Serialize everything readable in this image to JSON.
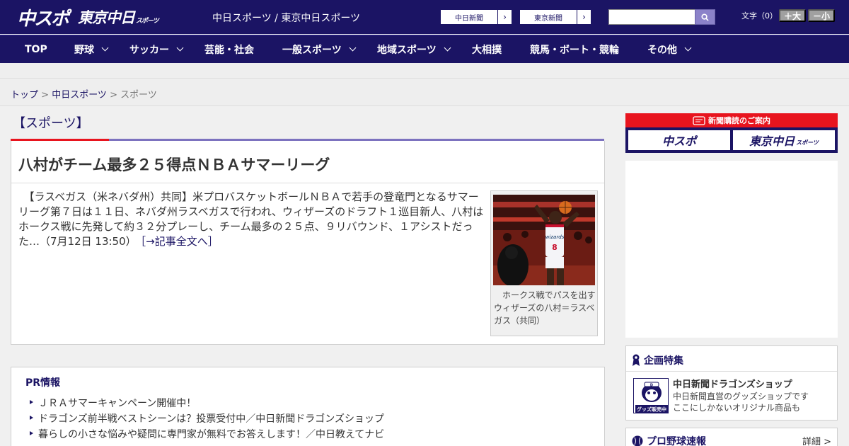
{
  "header": {
    "logo_chuspo": "中スポ",
    "logo_tokyo": "東京中日",
    "logo_tokyo_sub": "スポーツ",
    "title": "中日スポーツ / 東京中日スポーツ",
    "paper_links": [
      "中日新聞",
      "東京新聞"
    ],
    "search_placeholder": "",
    "font_label": "文字（0）",
    "font_plus": "＋大",
    "font_minus": "－小"
  },
  "nav": {
    "items": [
      {
        "label": "TOP"
      },
      {
        "label": "野球"
      },
      {
        "label": "サッカー"
      },
      {
        "label": "芸能・社会"
      },
      {
        "label": "一般スポーツ"
      },
      {
        "label": "地域スポーツ"
      },
      {
        "label": "大相撲"
      },
      {
        "label": "競馬・ボート・競輪"
      },
      {
        "label": "その他"
      }
    ]
  },
  "breadcrumb": {
    "home": "トップ",
    "sep": " > ",
    "parent": "中日スポーツ",
    "current": "スポーツ"
  },
  "section": {
    "heading": "【スポーツ】"
  },
  "article": {
    "title": "八村がチーム最多２５得点ＮＢＡサマーリーグ",
    "body": "　【ラスベガス（米ネバダ州）共同】米プロバスケットボールＮＢＡで若手の登竜門となるサマーリーグ第７日は１１日、ネバダ州ラスベガスで行われ、ウィザーズのドラフト１巡目新人、八村はホークス戦に先発して約３２分プレーし、チーム最多の２５点、９リバウンド、１アシストだった…（7月12日 13:50）",
    "more_link": "［→記事全文へ］",
    "photo_caption": "ホークス戦でパスを出すウィザーズの八村＝ラスベガス（共同）",
    "jersey_number": "8",
    "jersey_text": "wizards"
  },
  "pr": {
    "title": "PR情報",
    "items": [
      "ＪＲＡサマーキャンペーン開催中！",
      "ドラゴンズ前半戦ベストシーンは？投票受付中／中日新聞ドラゴンズショップ",
      "暮らしの小さな悩みや疑問に専門家が無料でお答えします！／中日教えてナビ"
    ]
  },
  "sidebar": {
    "subscribe_title": "新聞購読のご案内",
    "subscribe_chuspo": "中スポ",
    "subscribe_tokyo": "東京中日",
    "subscribe_tokyo_sub": "スポーツ",
    "feature_title": "企画特集",
    "shop_name": "中日新聞ドラゴンズショップ",
    "shop_desc_1": "中日新聞直営のグッズショップです",
    "shop_desc_2": "ここにしかないオリジナル商品も",
    "shop_badge": "グッズ販売中",
    "baseball_title": "プロ野球速報",
    "baseball_more": "詳細 >"
  },
  "colors": {
    "brand_navy": "#1b1464",
    "accent_red": "#e8141e",
    "accent_purple": "#7c72bf"
  }
}
